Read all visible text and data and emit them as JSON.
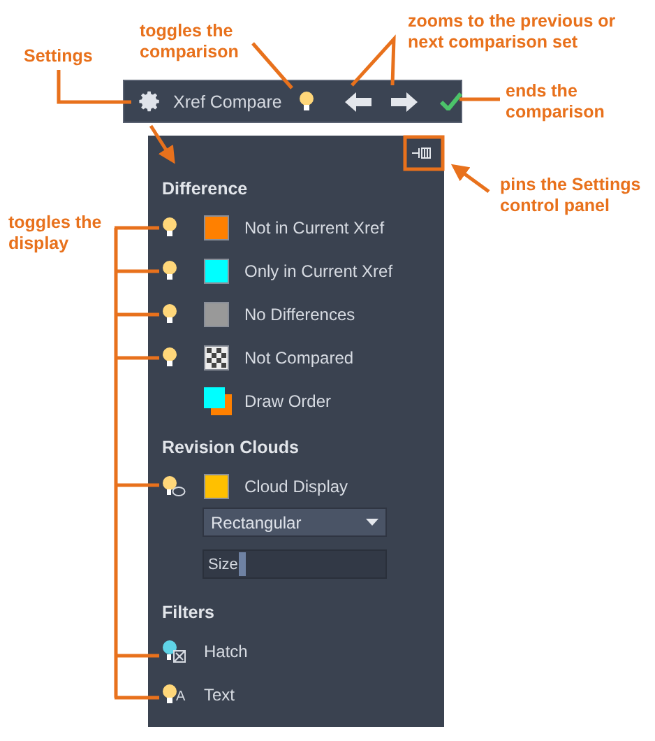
{
  "toolbar": {
    "title": "Xref Compare",
    "comparison_on": true
  },
  "panel": {
    "pinned": false,
    "difference": {
      "heading": "Difference",
      "rows": [
        {
          "kind": "toggle",
          "label": "Not in Current Xref",
          "color": "#ff8000",
          "on": true
        },
        {
          "kind": "toggle",
          "label": "Only in Current Xref",
          "color": "#00ffff",
          "on": true
        },
        {
          "kind": "toggle",
          "label": "No Differences",
          "color": "#999999",
          "on": true
        },
        {
          "kind": "pattern",
          "label": "Not Compared",
          "on": true
        },
        {
          "kind": "order",
          "label": "Draw Order"
        }
      ]
    },
    "revision_clouds": {
      "heading": "Revision Clouds",
      "label": "Cloud Display",
      "color": "#ffc000",
      "on": true,
      "shape": "Rectangular",
      "size_label": "Size",
      "level": 0.2
    },
    "filters": {
      "heading": "Filters",
      "items": [
        {
          "kind": "hatch",
          "label": "Hatch",
          "color": "#5fd3e6"
        },
        {
          "kind": "text",
          "label": "Text",
          "badge": "A",
          "color": "#ffd77a"
        }
      ]
    }
  },
  "annotations": [
    {
      "lines": [
        "Settings"
      ]
    },
    {
      "lines": [
        "toggles the",
        "comparison"
      ]
    },
    {
      "lines": [
        "zooms to the previous or",
        "next comparison set"
      ]
    },
    {
      "lines": [
        "ends the",
        "comparison"
      ]
    },
    {
      "lines": [
        "pins the Settings",
        "control panel"
      ]
    },
    {
      "lines": [
        "toggles the",
        "display"
      ]
    }
  ]
}
